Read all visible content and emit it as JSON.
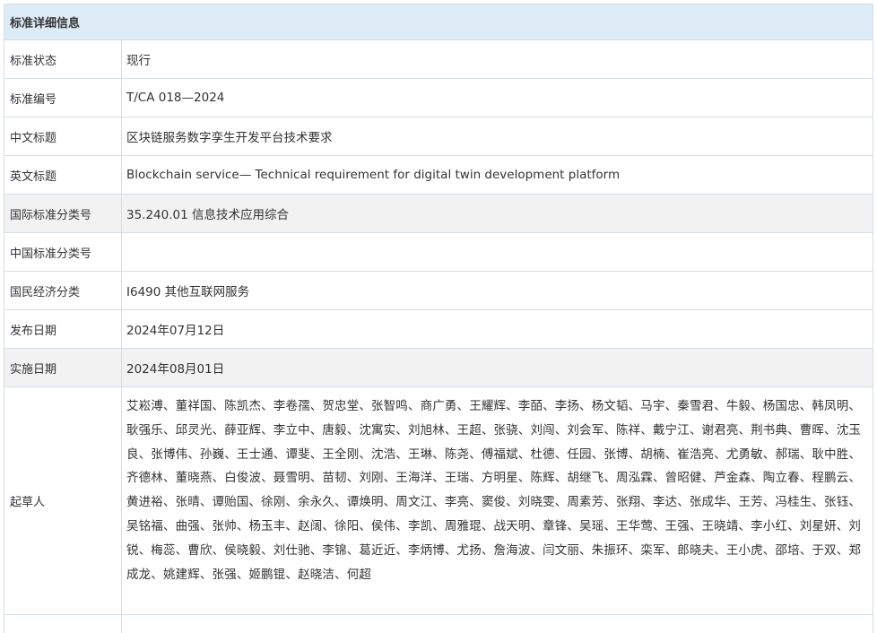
{
  "section_title": "标准详细信息",
  "rows": [
    {
      "label": "标准状态",
      "value": "现行"
    },
    {
      "label": "标准编号",
      "value": "T/CA 018—2024"
    },
    {
      "label": "中文标题",
      "value": "区块链服务数字孪生开发平台技术要求"
    },
    {
      "label": "英文标题",
      "value": "Blockchain service— Technical requirement for digital twin development platform"
    },
    {
      "label": "国际标准分类号",
      "value": "35.240.01 信息技术应用综合"
    },
    {
      "label": "中国标准分类号",
      "value": ""
    },
    {
      "label": "国民经济分类",
      "value": "I6490 其他互联网服务"
    },
    {
      "label": "发布日期",
      "value": "2024年07月12日"
    },
    {
      "label": "实施日期",
      "value": "2024年08月01日"
    }
  ],
  "drafters": {
    "label": "起草人",
    "value": "艾崧溥、董祥国、陈凯杰、李卷孺、贺忠堂、张智鸣、商广勇、王耀辉、李皕、李扬、杨文韬、马宇、秦雪君、牛毅、杨国忠、韩凤明、耿强乐、邱灵光、薛亚辉、李立中、唐毅、沈寓实、刘旭林、王超、张骁、刘闯、刘会军、陈祥、戴宁江、谢君亮、荆书典、曹晖、沈玉良、张博伟、孙巍、王士通、谭斐、王全刚、沈浩、王琳、陈尧、傅福斌、杜德、任园、张博、胡楠、崔浩亮、尤勇敏、郝瑞、耿中胜、齐德林、董晓燕、白俊波、聂雪明、苗韧、刘刚、王海洋、王瑞、方明星、陈辉、胡继飞、周泓霖、曾昭健、芦金森、陶立春、程鹏云、黄进裕、张晴、谭贻国、徐刚、余永久、谭焕明、周文江、李亮、窦俊、刘晓雯、周素芳、张翔、李达、张成华、王芳、冯桂生、张钰、吴铭福、曲强、张帅、杨玉丰、赵阔、徐阳、侯伟、李凯、周雅琨、战天明、章锋、吴瑶、王华莺、王强、王晓靖、李小红、刘星妍、刘锐、梅蕊、曹欣、侯晓毅、刘仕驰、李锦、葛近近、李炳博、尤扬、詹海波、闫文丽、朱振环、栾军、郎晓夫、王小虎、邵培、于双、郑成龙、姚建辉、张强、姬鹏锟、赵晓洁、何超"
  }
}
